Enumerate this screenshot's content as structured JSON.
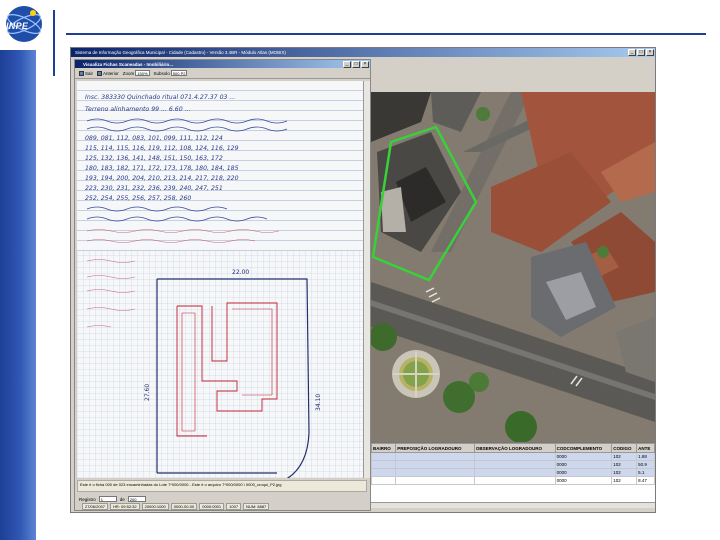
{
  "slide": {
    "logo_text": "INPE",
    "colors": {
      "band": "#1d3f96",
      "map_outline": "#39d13a"
    }
  },
  "app": {
    "title": "Sistema de Informação Geográfica Municipal - Cidade (Cadastro) - Versão 3.4BR - Módulo Atlas (MOBIX)",
    "window_buttons": [
      "_",
      "□",
      "×"
    ]
  },
  "viewer": {
    "title": "Visualiza Fichas Scaneadas - Imobiliário...",
    "window_buttons": [
      "_",
      "□",
      "×"
    ],
    "toolbar": {
      "save_label": "Sair",
      "previous_label": "Anterior",
      "zoom_label": "Zoom",
      "zoom_value": "150%",
      "resolution_label": "Subsolo",
      "resolution_value": "500 P2"
    },
    "ledger_lines": [
      "Insc. 383330 Quinchado ritual 071.4.27.37 03 ...",
      "Terreno alinhamento 99 ... 6.60 ...",
      "089, 081, 112, 083, 101, 099, 111, 112, 124",
      "115, 114, 115, 116, 119, 112, 108, 124, 116, 129",
      "125, 132, 136, 141, 148, 151, 150, 163, 172",
      "180, 183, 182, 171, 172, 173, 178, 180, 184, 185",
      "193, 194, 200, 204, 210, 213, 214, 217, 218, 220",
      "223, 230, 231, 232, 236, 239, 240, 247, 251",
      "252, 254, 255, 256, 257, 258, 260"
    ],
    "dimension_top": "22.00",
    "dimension_left": "27.60",
    "dimension_right": "34.10",
    "status_text": "Este é o ficha 000 de 023 encaminhadas do Lote 7*000/0000 - Este é o arquivo 7*000/0000 \\ 0000_croqui_P2.jpg",
    "pager": {
      "label": "Registro",
      "current": "1",
      "of_label": "de",
      "total": "200"
    }
  },
  "table": {
    "columns": [
      "BAIRRO",
      "PREPOSIÇÃO LOGRADOURO",
      "OBSERVAÇÃO LOGRADOURO",
      "CODCOMPLEMENTO",
      "CODIGO",
      "ANTE"
    ],
    "rows": [
      [
        "",
        "",
        "",
        "0000",
        "102",
        "1.88"
      ],
      [
        "",
        "",
        "",
        "0000",
        "102",
        "50.9"
      ],
      [
        "",
        "",
        "",
        "0000",
        "102",
        "5.1"
      ],
      [
        "",
        "",
        "",
        "0000",
        "102",
        "8.47"
      ]
    ]
  },
  "app_status": [
    "27/06/2007",
    "HR: 09:52:32",
    "20000:1000",
    "0000-00-00",
    "0000:0001",
    "1007",
    "NUM: 8887"
  ]
}
